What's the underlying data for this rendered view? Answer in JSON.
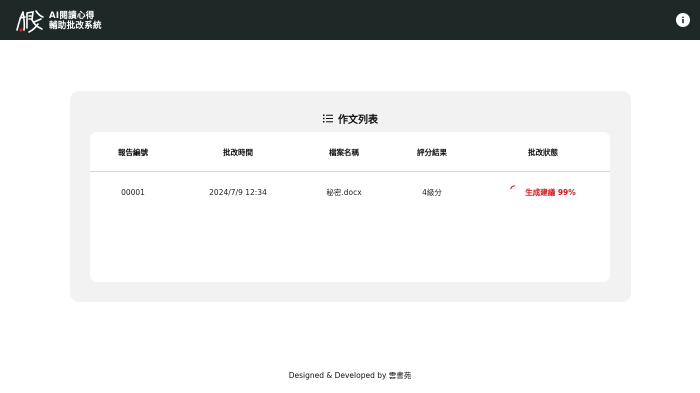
{
  "app": {
    "title_line1": "AI閱讀心得",
    "title_line2": "輔助批改系統"
  },
  "header": {
    "info_icon": "info-icon"
  },
  "panel": {
    "title": "作文列表",
    "title_icon": "list-icon"
  },
  "table": {
    "columns": [
      "報告編號",
      "批改時間",
      "檔案名稱",
      "評分結果",
      "批改狀態"
    ],
    "rows": [
      {
        "id": "00001",
        "time": "2024/7/9 12:34",
        "file": "秘密.docx",
        "score": "4級分",
        "status": "生成建議 99%"
      }
    ]
  },
  "colors": {
    "topbar": "#1e2826",
    "status": "#e0141a",
    "panel_bg": "#f2f2f2"
  },
  "footer": {
    "credit": "Designed & Developed by 雲書苑"
  }
}
